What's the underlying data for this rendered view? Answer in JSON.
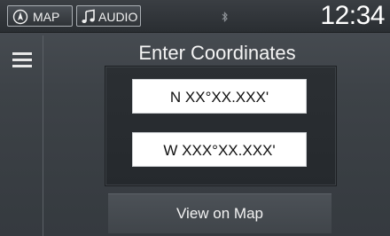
{
  "status_bar": {
    "map_label": "MAP",
    "audio_label": "AUDIO",
    "clock": "12:34",
    "icons": {
      "map": "compass-icon",
      "audio": "music-note-icon",
      "bluetooth": "bluetooth-icon"
    }
  },
  "menu": {
    "icon": "hamburger-menu-icon"
  },
  "page": {
    "title": "Enter Coordinates",
    "latitude_value": "N XX°XX.XXX'",
    "longitude_value": "W XXX°XX.XXX'",
    "view_on_map_label": "View on Map"
  },
  "colors": {
    "background": "#3d4247",
    "panel": "#2b2f33",
    "field": "#ffffff",
    "text": "#f4f4f4"
  }
}
